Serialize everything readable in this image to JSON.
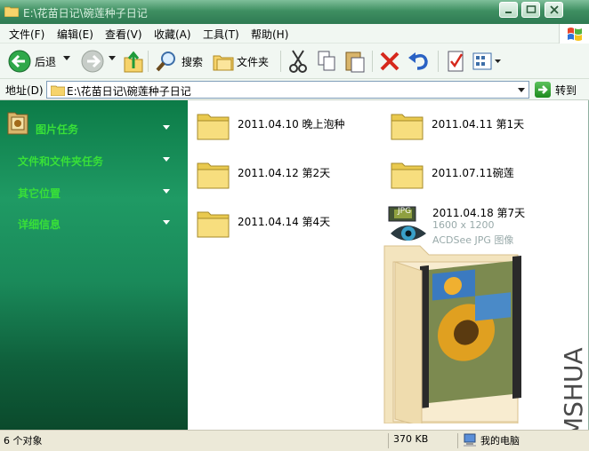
{
  "window": {
    "title": "E:\\花苗日记\\碗莲种子日记"
  },
  "menu": [
    {
      "label": "文件(F)"
    },
    {
      "label": "编辑(E)"
    },
    {
      "label": "查看(V)"
    },
    {
      "label": "收藏(A)"
    },
    {
      "label": "工具(T)"
    },
    {
      "label": "帮助(H)"
    }
  ],
  "toolbar": {
    "back_label": "后退",
    "search_label": "搜索",
    "folders_label": "文件夹"
  },
  "address": {
    "label": "地址(D)",
    "path": "E:\\花苗日记\\碗莲种子日记",
    "go_label": "转到"
  },
  "tasks": [
    {
      "label": "图片任务"
    },
    {
      "label": "文件和文件夹任务"
    },
    {
      "label": "其它位置"
    },
    {
      "label": "详细信息"
    }
  ],
  "files": [
    {
      "name": "2011.04.10 晚上泡种",
      "type": "folder"
    },
    {
      "name": "2011.04.11 第1天",
      "type": "folder"
    },
    {
      "name": "2011.04.12 第2天",
      "type": "folder"
    },
    {
      "name": "2011.07.11碗莲",
      "type": "folder"
    },
    {
      "name": "2011.04.14 第4天",
      "type": "folder"
    },
    {
      "name": "2011.04.18 第7天",
      "type": "jpg",
      "badge": "JPG",
      "dimensions": "1600 x 1200",
      "filetype": "ACDSee JPG 图像"
    }
  ],
  "status": {
    "count": "6 个对象",
    "size": "370 KB",
    "location": "我的电脑"
  },
  "watermark": "MSHUA",
  "colors": {
    "pane_green": "#1a8a5a",
    "task_text": "#38e038",
    "title_green": "#3f8f62"
  }
}
